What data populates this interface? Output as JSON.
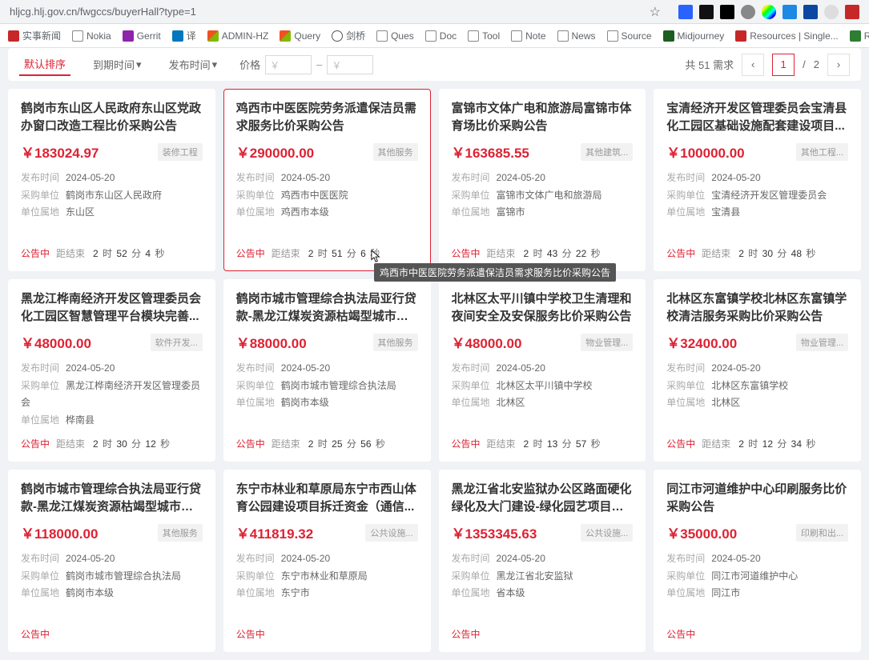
{
  "browser": {
    "url": "hljcg.hlj.gov.cn/fwgccs/buyerHall?type=1"
  },
  "bookmarks": [
    {
      "label": "实事新闻"
    },
    {
      "label": "Nokia"
    },
    {
      "label": "Gerrit"
    },
    {
      "label": "译"
    },
    {
      "label": "ADMIN-HZ"
    },
    {
      "label": "Query"
    },
    {
      "label": "剑桥"
    },
    {
      "label": "Ques"
    },
    {
      "label": "Doc"
    },
    {
      "label": "Tool"
    },
    {
      "label": "Note"
    },
    {
      "label": "News"
    },
    {
      "label": "Source"
    },
    {
      "label": "Midjourney"
    },
    {
      "label": "Resources | Single..."
    },
    {
      "label": "RAN BOAM O&..."
    }
  ],
  "filters": {
    "sort_default": "默认排序",
    "end_time": "到期时间",
    "pub_time": "发布时间",
    "price_label": "价格"
  },
  "pager": {
    "total_prefix": "共",
    "total_num": "51",
    "total_suffix": "需求",
    "current": "1",
    "sep": "/",
    "total_pages": "2"
  },
  "labels": {
    "pub": "发布时间",
    "buyer": "采购单位",
    "region": "单位属地",
    "status": "公告中",
    "until": "距结束",
    "h": "时",
    "m": "分",
    "s": "秒"
  },
  "tooltip": "鸡西市中医医院劳务派遣保洁员需求服务比价采购公告",
  "cards": [
    {
      "title": "鹤岗市东山区人民政府东山区党政办窗口改造工程比价采购公告",
      "price": "￥183024.97",
      "tag": "装修工程",
      "pub": "2024-05-20",
      "buyer": "鹤岗市东山区人民政府",
      "region": "东山区",
      "h": "2",
      "m": "52",
      "s": "4"
    },
    {
      "title": "鸡西市中医医院劳务派遣保洁员需求服务比价采购公告",
      "price": "￥290000.00",
      "tag": "其他服务",
      "pub": "2024-05-20",
      "buyer": "鸡西市中医医院",
      "region": "鸡西市本级",
      "h": "2",
      "m": "51",
      "s": "6",
      "hover": true
    },
    {
      "title": "富锦市文体广电和旅游局富锦市体育场比价采购公告",
      "price": "￥163685.55",
      "tag": "其他建筑...",
      "pub": "2024-05-20",
      "buyer": "富锦市文体广电和旅游局",
      "region": "富锦市",
      "h": "2",
      "m": "43",
      "s": "22"
    },
    {
      "title": "宝清经济开发区管理委员会宝清县化工园区基础设施配套建设项目...",
      "price": "￥100000.00",
      "tag": "其他工程...",
      "pub": "2024-05-20",
      "buyer": "宝清经济开发区管理委员会",
      "region": "宝清县",
      "h": "2",
      "m": "30",
      "s": "48"
    },
    {
      "title": "黑龙江桦南经济开发区管理委员会化工园区智慧管理平台模块完善...",
      "price": "￥48000.00",
      "tag": "软件开发...",
      "pub": "2024-05-20",
      "buyer": "黑龙江桦南经济开发区管理委员会",
      "region": "桦南县",
      "h": "2",
      "m": "30",
      "s": "12"
    },
    {
      "title": "鹤岗市城市管理综合执法局亚行贷款-黑龙江煤炭资源枯竭型城市转...",
      "price": "￥88000.00",
      "tag": "其他服务",
      "pub": "2024-05-20",
      "buyer": "鹤岗市城市管理综合执法局",
      "region": "鹤岗市本级",
      "h": "2",
      "m": "25",
      "s": "56"
    },
    {
      "title": "北林区太平川镇中学校卫生清理和夜间安全及安保服务比价采购公告",
      "price": "￥48000.00",
      "tag": "物业管理...",
      "pub": "2024-05-20",
      "buyer": "北林区太平川镇中学校",
      "region": "北林区",
      "h": "2",
      "m": "13",
      "s": "57"
    },
    {
      "title": "北林区东富镇学校北林区东富镇学校清洁服务采购比价采购公告",
      "price": "￥32400.00",
      "tag": "物业管理...",
      "pub": "2024-05-20",
      "buyer": "北林区东富镇学校",
      "region": "北林区",
      "h": "2",
      "m": "12",
      "s": "34"
    },
    {
      "title": "鹤岗市城市管理综合执法局亚行贷款-黑龙江煤炭资源枯竭型城市转...",
      "price": "￥118000.00",
      "tag": "其他服务",
      "pub": "2024-05-20",
      "buyer": "鹤岗市城市管理综合执法局",
      "region": "鹤岗市本级",
      "h": "",
      "m": "",
      "s": ""
    },
    {
      "title": "东宁市林业和草原局东宁市西山体育公园建设项目拆迁资金（通信...",
      "price": "￥411819.32",
      "tag": "公共设施...",
      "pub": "2024-05-20",
      "buyer": "东宁市林业和草原局",
      "region": "东宁市",
      "h": "",
      "m": "",
      "s": ""
    },
    {
      "title": "黑龙江省北安监狱办公区路面硬化绿化及大门建设-绿化园艺项目比...",
      "price": "￥1353345.63",
      "tag": "公共设施...",
      "pub": "2024-05-20",
      "buyer": "黑龙江省北安监狱",
      "region": "省本级",
      "h": "",
      "m": "",
      "s": ""
    },
    {
      "title": "同江市河道维护中心印刷服务比价采购公告",
      "price": "￥35000.00",
      "tag": "印刷和出...",
      "pub": "2024-05-20",
      "buyer": "同江市河道维护中心",
      "region": "同江市",
      "h": "",
      "m": "",
      "s": ""
    }
  ]
}
